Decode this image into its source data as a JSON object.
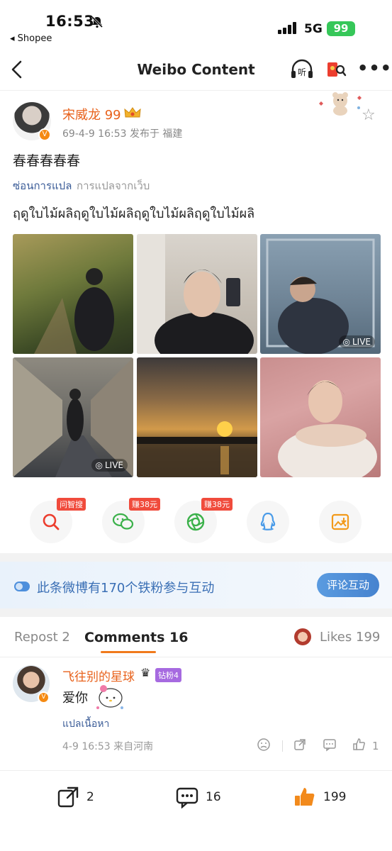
{
  "status_bar": {
    "time": "16:53",
    "back_app": "◂ Shopee",
    "network": "5G",
    "battery": "99"
  },
  "nav": {
    "title": "Weibo Content",
    "listen_label": "听"
  },
  "post": {
    "username": "宋威龙 99",
    "meta": "69-4-9 16:53  发布于 福建",
    "text": "春春春春春",
    "hide_translation": "ซ่อนการแปล",
    "translation_source": "การแปลจากเว็บ",
    "translated_text": "ฤดูใบไม้ผลิฤดูใบไม้ผลิฤดูใบไม้ผลิฤดูใบไม้ผลิ",
    "live_label": "LIVE",
    "photos": [
      {
        "desc": "man walking in autumn forest",
        "live": false
      },
      {
        "desc": "mirror selfie",
        "live": false
      },
      {
        "desc": "man behind glass",
        "live": true
      },
      {
        "desc": "hotel corridor",
        "live": true
      },
      {
        "desc": "sunset over water",
        "live": false
      },
      {
        "desc": "portrait pink background",
        "live": false
      }
    ]
  },
  "share_actions": [
    {
      "name": "ask-search",
      "tag": "问智搜",
      "icon": "search-icon"
    },
    {
      "name": "wechat",
      "tag": "赚38元",
      "icon": "wechat-icon"
    },
    {
      "name": "moments",
      "tag": "赚38元",
      "icon": "moments-icon"
    },
    {
      "name": "qq",
      "tag": "",
      "icon": "qq-icon"
    },
    {
      "name": "save-image",
      "tag": "",
      "icon": "save-image-icon"
    }
  ],
  "fans_banner": {
    "text": "此条微博有170个铁粉参与互动",
    "button": "评论互动"
  },
  "tabs": {
    "repost": "Repost 2",
    "comments": "Comments 16",
    "likes": "Likes 199"
  },
  "comment": {
    "name": "飞往别的星球",
    "badge": "钻粉4",
    "text": "爱你",
    "translate": "แปลเนื้อหา",
    "meta": "4-9 16:53  来自河南",
    "like_count": "1"
  },
  "bottom_bar": {
    "repost_count": "2",
    "comment_count": "16",
    "like_count": "199"
  },
  "colors": {
    "accent_orange": "#e8621c",
    "link_blue": "#3c5d98",
    "battery_green": "#36c759"
  }
}
